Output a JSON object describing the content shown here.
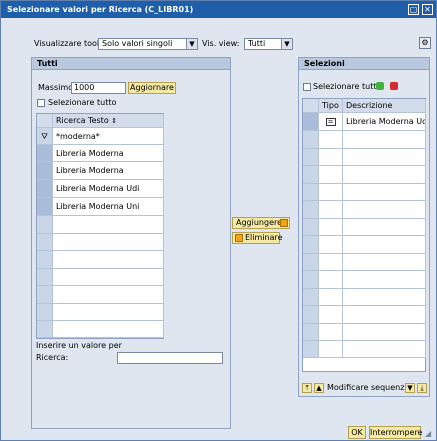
{
  "window": {
    "title": "Selezionare valori per Ricerca (C_LIBR01)",
    "menu_icon": "dialog-menu-icon",
    "close_icon": "close-icon"
  },
  "toolbar": {
    "view_tool_label": "Visualizzare tool:",
    "view_tool_value": "Solo valori singoli",
    "vis_view_label": "Vis. view:",
    "vis_view_value": "Tutti",
    "settings_icon": "settings-icon"
  },
  "left_panel": {
    "title": "Tutti",
    "massimo_label": "Massimo",
    "massimo_value": "1000",
    "refresh_button": "Aggiornare",
    "select_all_label": "Selezionare tutto",
    "column_header": "Ricerca Testo",
    "filter_value": "*moderna*",
    "rows": [
      "Libreria Moderna",
      "Libreria Moderna",
      "Libreria Moderna Udi",
      "Libreria Moderna Uni"
    ],
    "input_hint": "Inserire un valore per",
    "input_label": "Ricerca:",
    "input_value": ""
  },
  "middle": {
    "add_button": "Aggiungere",
    "remove_button": "Eliminare"
  },
  "right_panel": {
    "title": "Selezioni",
    "select_all_label": "Selezionare tutto",
    "col_tipo": "Tipo",
    "col_descrizione": "Descrizione",
    "rows": [
      {
        "tipo_icon": "equals-icon",
        "descrizione": "Libreria Moderna Udi"
      }
    ],
    "reorder_label": "Modificare sequenza"
  },
  "footer": {
    "ok_button": "OK",
    "cancel_button": "Interrompere"
  },
  "colors": {
    "titlebar": "#1f5ea8",
    "button_bg": "#f5e9a6",
    "green": "#3fb43f",
    "red": "#d52a2a"
  }
}
